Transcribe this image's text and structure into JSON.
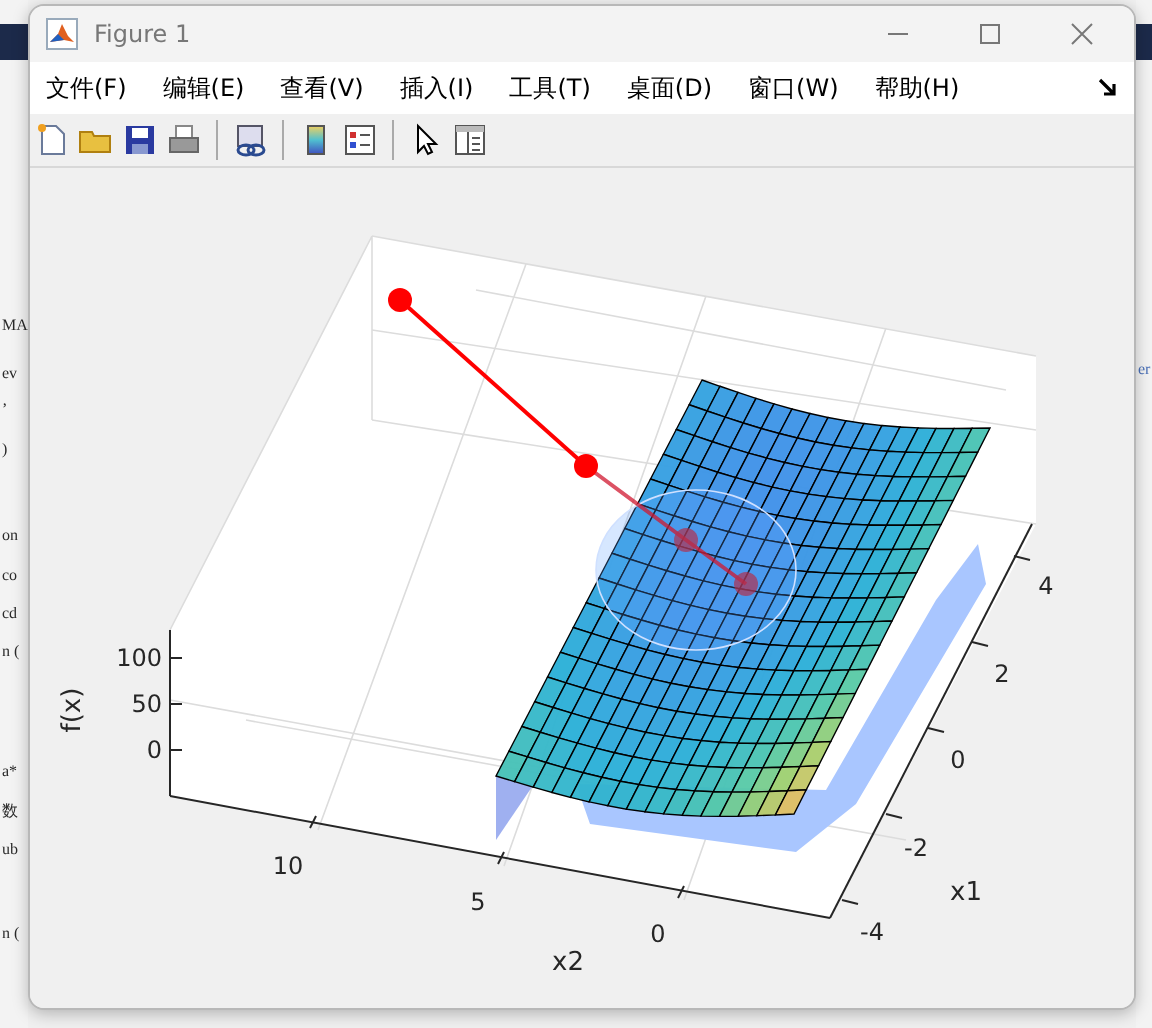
{
  "background_editor": {
    "left_fragments": [
      "MA",
      "ev",
      "’",
      ")",
      "on",
      "co",
      "cd",
      "n (",
      "a*",
      "数",
      "ub",
      "n ("
    ],
    "right_fragments": [
      "er"
    ]
  },
  "window": {
    "title": "Figure 1"
  },
  "menu": [
    "文件(F)",
    "编辑(E)",
    "查看(V)",
    "插入(I)",
    "工具(T)",
    "桌面(D)",
    "窗口(W)",
    "帮助(H)"
  ],
  "plot": {
    "zlabel": "f(x)",
    "xlabel": "x2",
    "ylabel": "x1",
    "z_ticks": [
      "100",
      "50",
      "0"
    ],
    "x2_ticks": [
      "10",
      "5",
      "0"
    ],
    "x1_ticks": [
      "4",
      "2",
      "0",
      "-2",
      "-4"
    ]
  }
}
